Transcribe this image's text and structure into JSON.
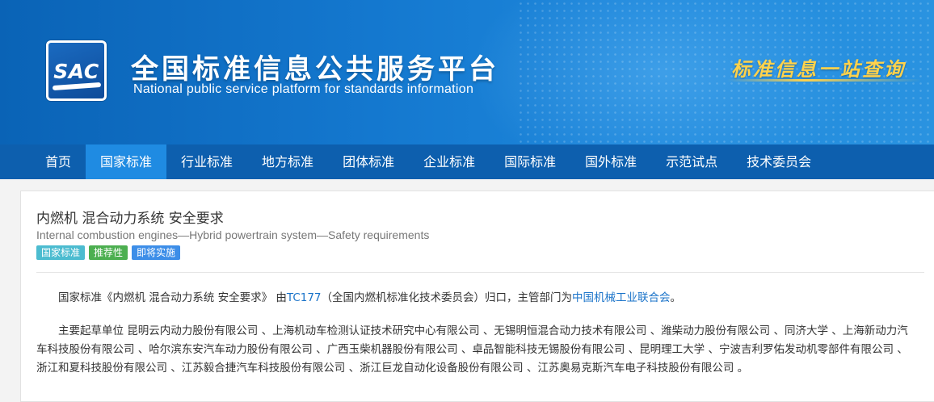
{
  "header": {
    "logo_text": "SAC",
    "title_cn": "全国标准信息公共服务平台",
    "title_en": "National public service platform  for standards information",
    "slogan": "标准信息一站查询"
  },
  "nav": {
    "items": [
      "首页",
      "国家标准",
      "行业标准",
      "地方标准",
      "团体标准",
      "企业标准",
      "国际标准",
      "国外标准",
      "示范试点",
      "技术委员会"
    ],
    "active_index": 1
  },
  "standard": {
    "title_cn": "内燃机 混合动力系统 安全要求",
    "title_en": "Internal combustion engines—Hybrid powertrain system—Safety requirements",
    "badges": [
      "国家标准",
      "推荐性",
      "即将实施"
    ],
    "para1": {
      "prefix": "国家标准《内燃机 混合动力系统 安全要求》 由",
      "tc_link": "TC177",
      "tc_desc": "（全国内燃机标准化技术委员会）归口，主管部门为",
      "dept_link": "中国机械工业联合会",
      "suffix": "。"
    },
    "para2": "主要起草单位 昆明云内动力股份有限公司 、上海机动车检测认证技术研究中心有限公司 、无锡明恒混合动力技术有限公司 、潍柴动力股份有限公司 、同济大学 、上海新动力汽车科技股份有限公司 、哈尔滨东安汽车动力股份有限公司 、广西玉柴机器股份有限公司 、卓品智能科技无锡股份有限公司 、昆明理工大学 、宁波吉利罗佑发动机零部件有限公司 、浙江和夏科技股份有限公司 、江苏毅合捷汽车科技股份有限公司 、浙江巨龙自动化设备股份有限公司 、江苏奥易克斯汽车电子科技股份有限公司 。"
  }
}
